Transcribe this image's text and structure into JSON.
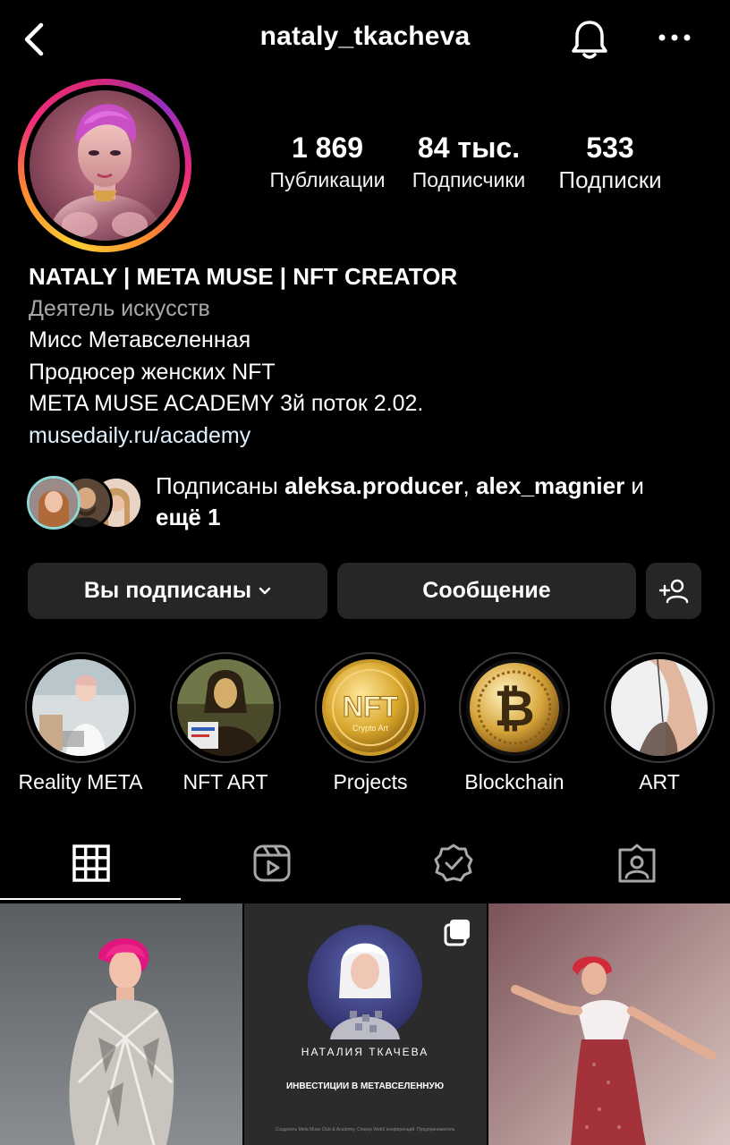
{
  "header": {
    "username": "nataly_tkacheva",
    "icons": [
      "chevron-left-icon",
      "bell-icon",
      "more-icon"
    ]
  },
  "stats": [
    {
      "value": "1 869",
      "label": "Публикации"
    },
    {
      "value": "84 тыс.",
      "label": "Подписчики"
    },
    {
      "value": "533",
      "label": "Подписки"
    }
  ],
  "bio": {
    "name": "NATALY | META MUSE | NFT CREATOR",
    "category": "Деятель искусств",
    "lines": [
      "Мисс Метавселенная",
      "Продюсер женских NFT",
      "META MUSE ACADEMY 3й поток 2.02."
    ],
    "link": "musedaily.ru/academy"
  },
  "followed_by": {
    "prefix": "Подписаны ",
    "user1": "aleksa.producer",
    "sep": ", ",
    "user2": "alex_magnier",
    "conj": " и",
    "more": "ещё 1"
  },
  "actions": {
    "follow_label": "Вы подписаны",
    "message_label": "Сообщение"
  },
  "highlights": [
    {
      "label": "Reality META"
    },
    {
      "label": "NFT ART"
    },
    {
      "label": "Projects",
      "badge_text": "NFT",
      "badge_sub": "Crypto Art"
    },
    {
      "label": "Blockchain",
      "coin_symbol": "₿"
    },
    {
      "label": "ART"
    }
  ],
  "tabs": [
    "grid-icon",
    "reels-icon",
    "tagged-check-icon",
    "person-tag-icon"
  ],
  "posts": [
    {},
    {
      "title": "НАТАЛИЯ ТКАЧЕВА",
      "subtitle": "ИНВЕСТИЦИИ В МЕТАВСЕЛЕННУЮ",
      "footnote": "Создатель Meta Muse Club & Academy. Спикер Web3 конференций. Предприниматель"
    },
    {}
  ],
  "colors": {
    "background": "#000000",
    "button": "#262626",
    "muted_text": "#a8a8a8",
    "link": "#e0f1ff"
  }
}
